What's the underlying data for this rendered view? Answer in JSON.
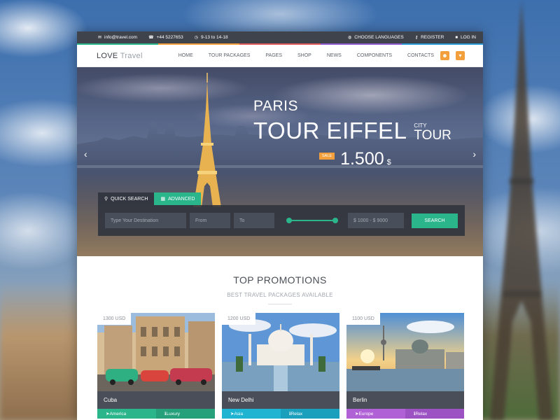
{
  "topbar": {
    "email": "info@travel.com",
    "phone": "+44 5227653",
    "hours": "9-13 to 14-18",
    "languages": "CHOOSE LANGUAGES",
    "register": "REGISTER",
    "login": "LOG IN"
  },
  "navbar": {
    "logo_bold": "LOVE",
    "logo_light": "Travel",
    "items": [
      "HOME",
      "TOUR PACKAGES",
      "PAGES",
      "SHOP",
      "NEWS",
      "COMPONENTS",
      "CONTACTS"
    ]
  },
  "hero": {
    "city": "PARIS",
    "title": "TOUR EIFFEL",
    "city_small": "CITY",
    "tour": "TOUR",
    "sale": "SALE",
    "price": "1.500",
    "currency": "$"
  },
  "search": {
    "tab_quick": "QUICK SEARCH",
    "tab_advanced": "ADVANCED",
    "destination_placeholder": "Type Your Destination",
    "from_placeholder": "From",
    "to_placeholder": "To",
    "price_range": "$ 1000 - $ 9000",
    "button": "SEARCH"
  },
  "promotions": {
    "title": "TOP PROMOTIONS",
    "subtitle": "BEST TRAVEL PACKAGES AVAILABLE",
    "cards": [
      {
        "price": "1300 USD",
        "city": "Cuba",
        "tag1": "America",
        "tag2": "Luxury"
      },
      {
        "price": "1200 USD",
        "city": "New Delhi",
        "tag1": "Asia",
        "tag2": "Relax"
      },
      {
        "price": "1100 USD",
        "city": "Berlin",
        "tag1": "Europe",
        "tag2": "Relax"
      }
    ]
  },
  "colors": {
    "accent_green": "#2bb58b",
    "accent_orange": "#f29f3c",
    "dark": "#3f434c",
    "blue": "#1fb4d2",
    "purple": "#b061d6"
  },
  "icons": {
    "topbar": [
      "envelope-icon",
      "phone-icon",
      "clock-icon",
      "globe-icon",
      "key-icon",
      "lock-icon"
    ],
    "navbar": [
      "user-icon",
      "cart-icon"
    ],
    "hero": [
      "chevron-left-icon",
      "chevron-right-icon"
    ],
    "search": [
      "search-icon",
      "grid-icon"
    ],
    "tags": [
      "plane-icon",
      "info-icon"
    ]
  }
}
